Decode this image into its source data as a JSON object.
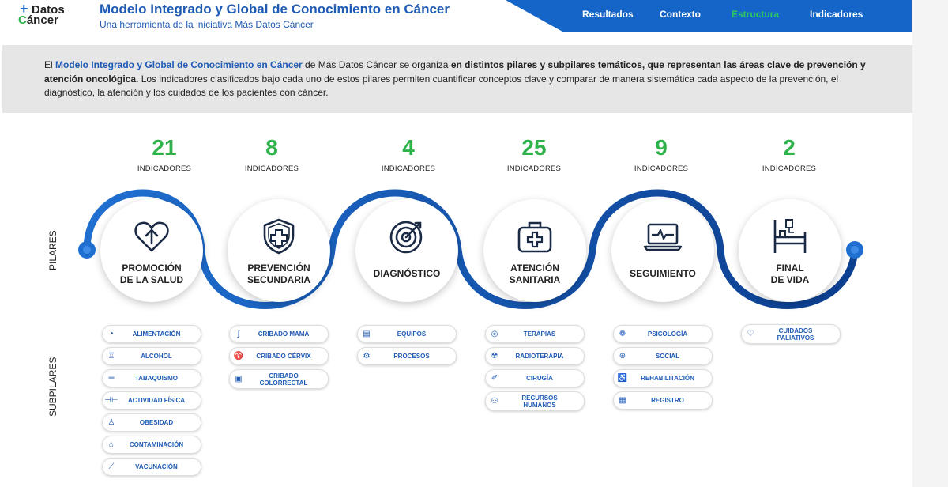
{
  "logo": {
    "plus": "+",
    "line1": "Datos",
    "line2_first": "C",
    "line2_rest": "áncer"
  },
  "header": {
    "title": "Modelo Integrado y Global de Conocimiento en Cáncer",
    "subtitle": "Una herramienta de la iniciativa Más Datos Cáncer"
  },
  "nav": [
    {
      "label": "Resultados",
      "active": false
    },
    {
      "label": "Contexto",
      "active": false
    },
    {
      "label": "Estructura",
      "active": true
    },
    {
      "label": "Indicadores",
      "active": false
    }
  ],
  "intro": {
    "p1": "El ",
    "p2": "Modelo Integrado y Global de Conocimiento en Cáncer",
    "p3": " de Más Datos Cáncer se organiza ",
    "p4": "en distintos pilares y subpilares temáticos, que representan las áreas clave de prevención y atención oncológica.",
    "p5": " Los indicadores clasificados bajo cada uno de estos pilares permiten cuantificar conceptos clave y comparar de manera sistemática cada aspecto de la prevención, el diagnóstico, la atención y los cuidados de los pacientes con cáncer."
  },
  "labels": {
    "pilares": "PILARES",
    "subpilares": "SUBPILARES"
  },
  "colors": {
    "accent_blue": "#1565c9",
    "green": "#2db34a",
    "text_blue": "#1f5bb5"
  },
  "pillars": [
    {
      "count": "21",
      "count_label": "INDICADORES",
      "title": "PROMOCIÓN\nDE LA SALUD",
      "icon": "heart-arrow-icon",
      "subs": [
        {
          "label": "ALIMENTACIÓN",
          "icon": "apple-icon",
          "glyph": "🍎"
        },
        {
          "label": "ALCOHOL",
          "icon": "bottle-icon",
          "glyph": "🍷"
        },
        {
          "label": "TABAQUISMO",
          "icon": "cigarette-icon",
          "glyph": "🚬"
        },
        {
          "label": "ACTIVIDAD FÍSICA",
          "icon": "dumbbell-icon",
          "glyph": "⚒"
        },
        {
          "label": "OBESIDAD",
          "icon": "body-icon",
          "glyph": "♙"
        },
        {
          "label": "CONTAMINACIÓN",
          "icon": "factory-icon",
          "glyph": "⌂"
        },
        {
          "label": "VACUNACIÓN",
          "icon": "syringe-icon",
          "glyph": "✎"
        }
      ]
    },
    {
      "count": "8",
      "count_label": "INDICADORES",
      "title": "PREVENCIÓN\nSECUNDARIA",
      "icon": "shield-cross-icon",
      "subs": [
        {
          "label": "CRIBADO MAMA",
          "icon": "ribbon-icon",
          "glyph": "ʃ"
        },
        {
          "label": "CRIBADO CÉRVIX",
          "icon": "uterus-icon",
          "glyph": "♈"
        },
        {
          "label": "CRIBADO\nCOLORRECTAL",
          "icon": "intestine-icon",
          "glyph": "▣"
        }
      ]
    },
    {
      "count": "4",
      "count_label": "INDICADORES",
      "title": "DIAGNÓSTICO",
      "icon": "target-icon",
      "subs": [
        {
          "label": "EQUIPOS",
          "icon": "monitor-icon",
          "glyph": "▤"
        },
        {
          "label": "PROCESOS",
          "icon": "gears-icon",
          "glyph": "⚙"
        }
      ]
    },
    {
      "count": "25",
      "count_label": "INDICADORES",
      "title": "ATENCIÓN\nSANITARIA",
      "icon": "medkit-icon",
      "subs": [
        {
          "label": "TERAPIAS",
          "icon": "pill-icon",
          "glyph": "◎"
        },
        {
          "label": "RADIOTERAPIA",
          "icon": "radiation-icon",
          "glyph": "☢"
        },
        {
          "label": "CIRUGÍA",
          "icon": "scalpel-icon",
          "glyph": "✐"
        },
        {
          "label": "RECURSOS\nHUMANOS",
          "icon": "people-icon",
          "glyph": "⚇"
        }
      ]
    },
    {
      "count": "9",
      "count_label": "INDICADORES",
      "title": "SEGUIMIENTO",
      "icon": "laptop-pulse-icon",
      "subs": [
        {
          "label": "PSICOLOGÍA",
          "icon": "brain-icon",
          "glyph": "❁"
        },
        {
          "label": "SOCIAL",
          "icon": "globe-icon",
          "glyph": "⊕"
        },
        {
          "label": "REHABILITACIÓN",
          "icon": "wheelchair-icon",
          "glyph": "♿"
        },
        {
          "label": "REGISTRO",
          "icon": "document-icon",
          "glyph": "▦"
        }
      ]
    },
    {
      "count": "2",
      "count_label": "INDICADORES",
      "title": "FINAL\nDE VIDA",
      "icon": "hospital-bed-icon",
      "subs": [
        {
          "label": "CUIDADOS\nPALIATIVOS",
          "icon": "heart-hand-icon",
          "glyph": "♡"
        }
      ]
    }
  ]
}
